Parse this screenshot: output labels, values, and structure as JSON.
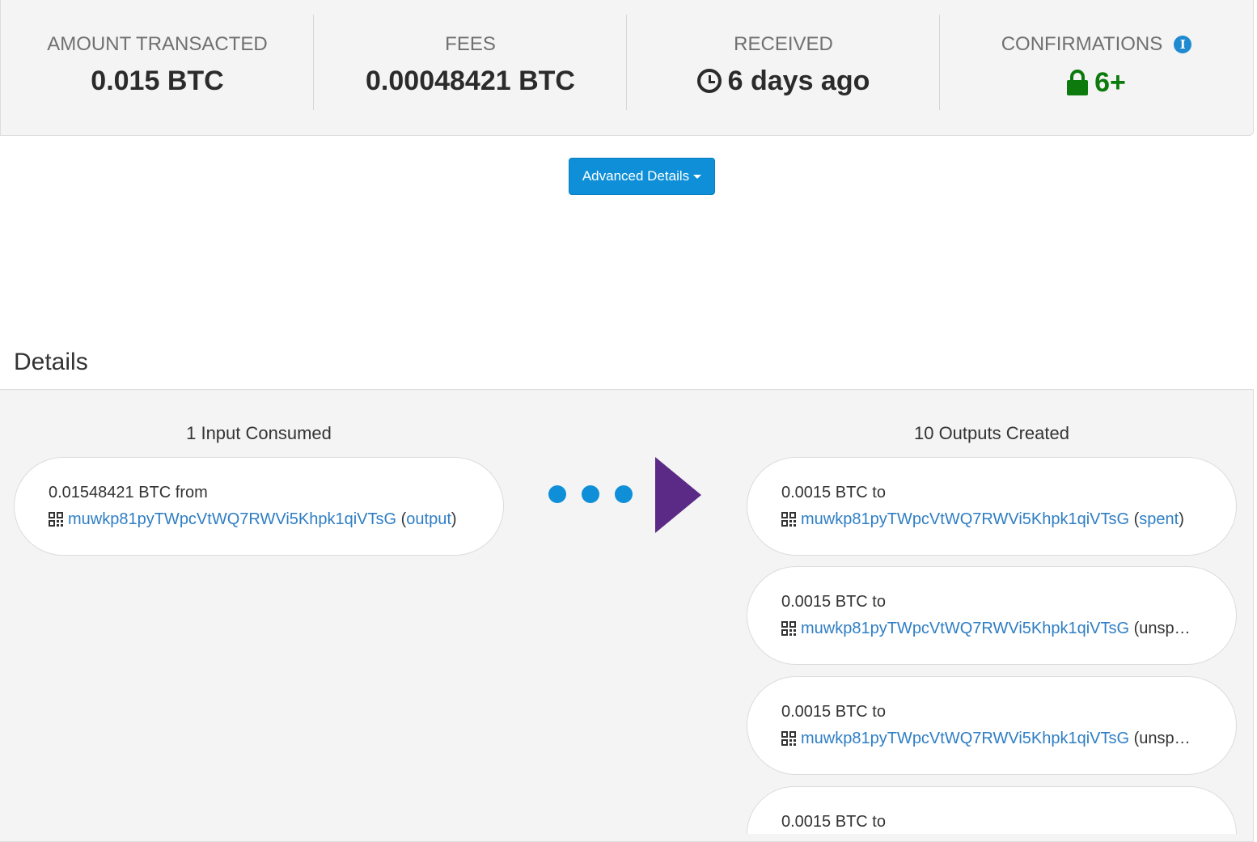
{
  "summary": {
    "amount_label": "AMOUNT TRANSACTED",
    "amount_value": "0.015 BTC",
    "fees_label": "FEES",
    "fees_value": "0.00048421 BTC",
    "received_label": "RECEIVED",
    "received_value": "6 days ago",
    "confirmations_label": "CONFIRMATIONS",
    "confirmations_value": "6+"
  },
  "advanced_button_label": "Advanced Details",
  "details_title": "Details",
  "inputs_title": "1 Input Consumed",
  "outputs_title": "10 Outputs Created",
  "inputs": [
    {
      "amount": "0.01548421 BTC",
      "direction": "from",
      "address": "muwkp81pyTWpcVtWQ7RWVi5Khpk1qiVTsG",
      "status": "output"
    }
  ],
  "outputs": [
    {
      "amount": "0.0015 BTC",
      "direction": "to",
      "address": "muwkp81pyTWpcVtWQ7RWVi5Khpk1qiVTsG",
      "status": "spent"
    },
    {
      "amount": "0.0015 BTC",
      "direction": "to",
      "address": "muwkp81pyTWpcVtWQ7RWVi5Khpk1qiVTsG",
      "status": "unspent"
    },
    {
      "amount": "0.0015 BTC",
      "direction": "to",
      "address": "muwkp81pyTWpcVtWQ7RWVi5Khpk1qiVTsG",
      "status": "unspent"
    },
    {
      "amount": "0.0015 BTC",
      "direction": "to",
      "address": "",
      "status": ""
    }
  ],
  "colors": {
    "accent_blue": "#0e8fd8",
    "link_blue": "#2f7ec4",
    "confirm_green": "#0d7a0d",
    "arrow_purple": "#5b2a86"
  },
  "icons": [
    "info-icon",
    "clock-icon",
    "lock-icon",
    "caret-down-icon",
    "qr-code-icon",
    "arrow-right-icon"
  ]
}
